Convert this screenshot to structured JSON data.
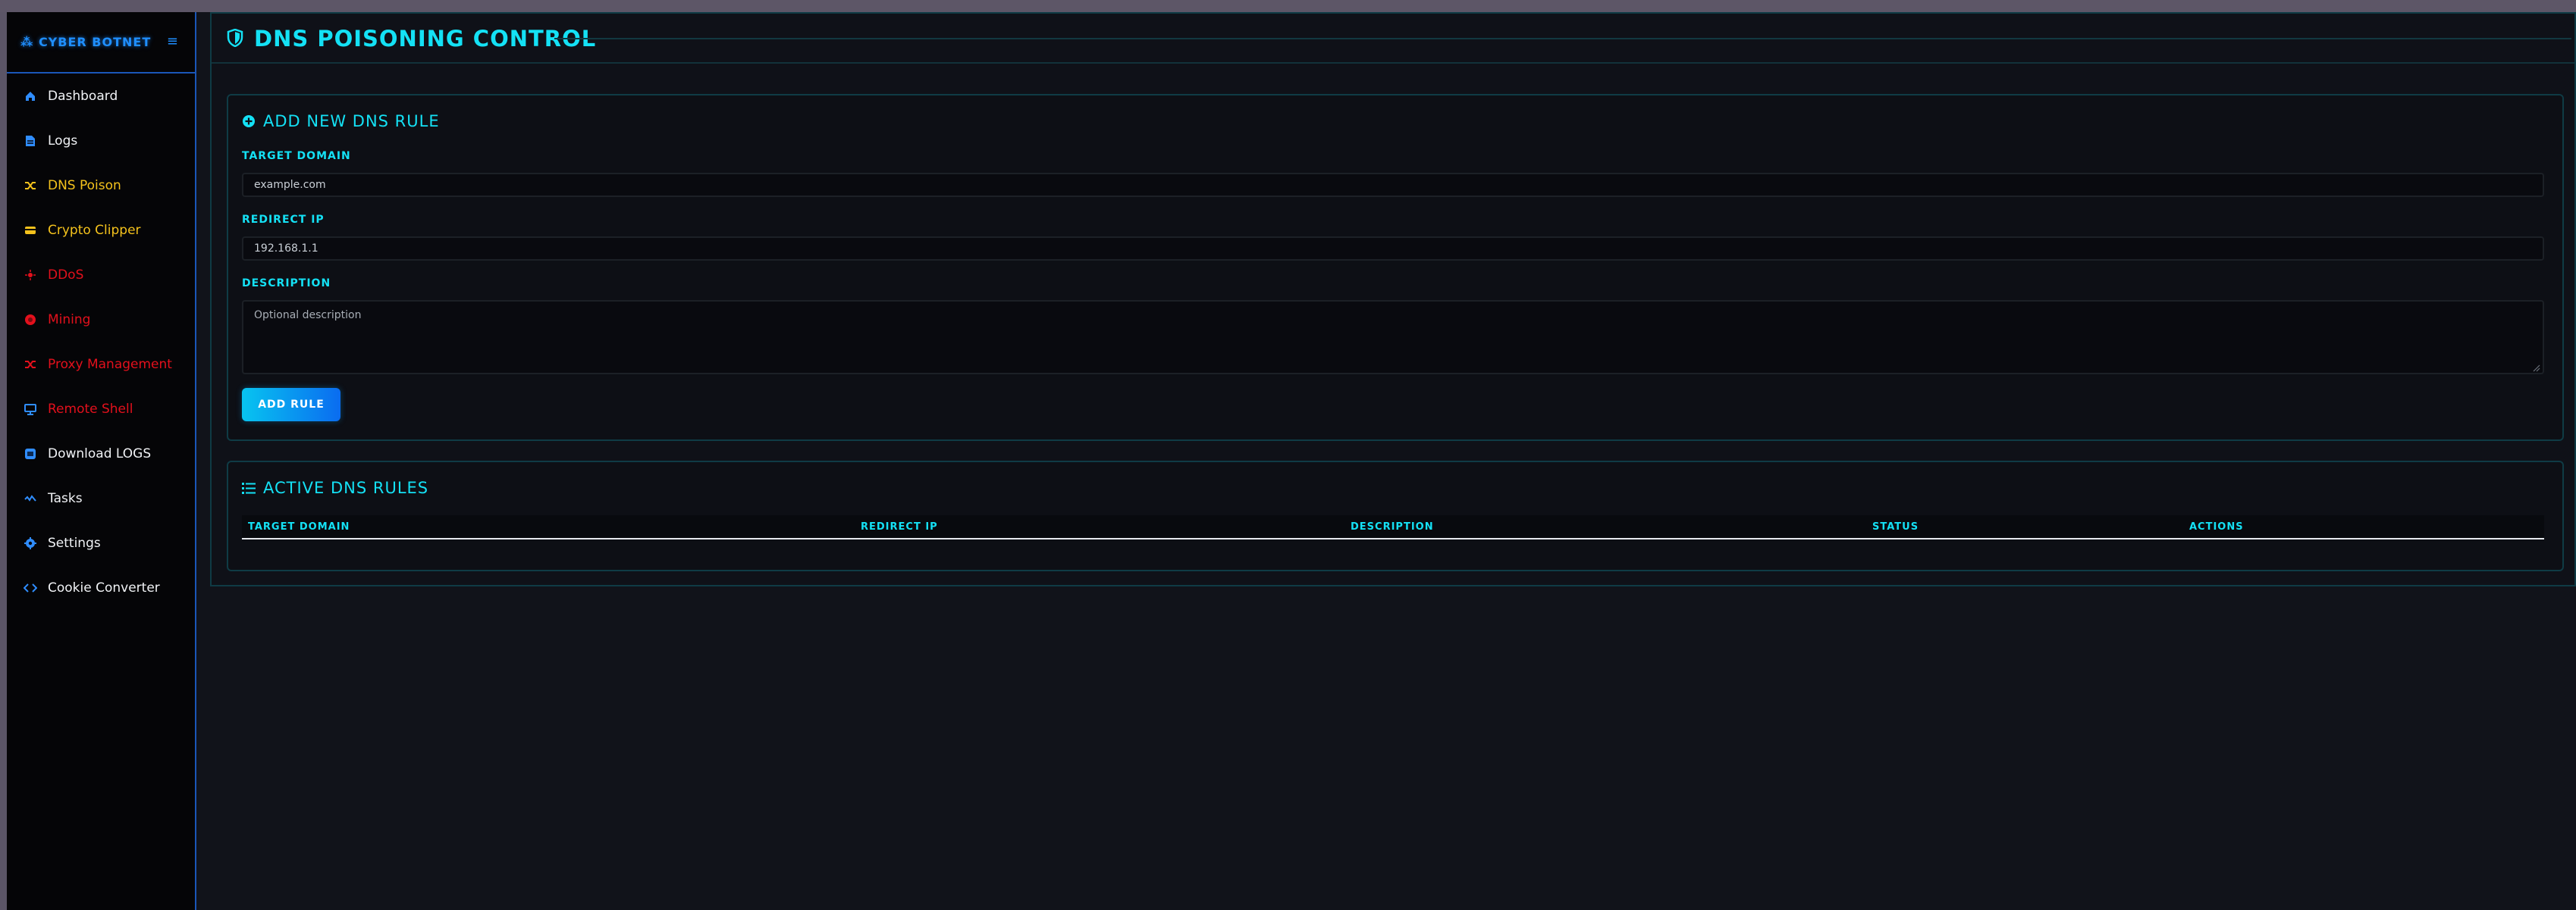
{
  "sidebar": {
    "brand": "⁂ CYBER BOTNET",
    "menu_toggle": "≡",
    "items": [
      {
        "label": "Dashboard",
        "icon": "home-icon"
      },
      {
        "label": "Logs",
        "icon": "file-icon"
      },
      {
        "label": "DNS Poison",
        "icon": "shuffle-icon"
      },
      {
        "label": "Crypto Clipper",
        "icon": "wallet-icon"
      },
      {
        "label": "DDoS",
        "icon": "burst-icon"
      },
      {
        "label": "Mining",
        "icon": "coin-icon"
      },
      {
        "label": "Proxy Management",
        "icon": "shuffle-icon"
      },
      {
        "label": "Remote Shell",
        "icon": "monitor-icon"
      },
      {
        "label": "Download LOGS",
        "icon": "download-icon"
      },
      {
        "label": "Tasks",
        "icon": "activity-icon"
      },
      {
        "label": "Settings",
        "icon": "gear-icon"
      },
      {
        "label": "Cookie Converter",
        "icon": "code-icon"
      }
    ]
  },
  "page": {
    "title": "DNS POISONING CONTROL"
  },
  "add_rule": {
    "title": "ADD NEW DNS RULE",
    "target_domain_label": "TARGET DOMAIN",
    "target_domain_placeholder": "example.com",
    "redirect_ip_label": "REDIRECT IP",
    "redirect_ip_placeholder": "192.168.1.1",
    "description_label": "DESCRIPTION",
    "description_placeholder": "Optional description",
    "button": "ADD RULE"
  },
  "active_rules": {
    "title": "ACTIVE DNS RULES",
    "columns": [
      "TARGET DOMAIN",
      "REDIRECT IP",
      "DESCRIPTION",
      "STATUS",
      "ACTIONS"
    ]
  },
  "colors": {
    "accent_cyan": "#14e1f5",
    "accent_blue": "#1f8fff",
    "warning_yellow": "#f4c21c",
    "danger_red": "#e3101c"
  }
}
